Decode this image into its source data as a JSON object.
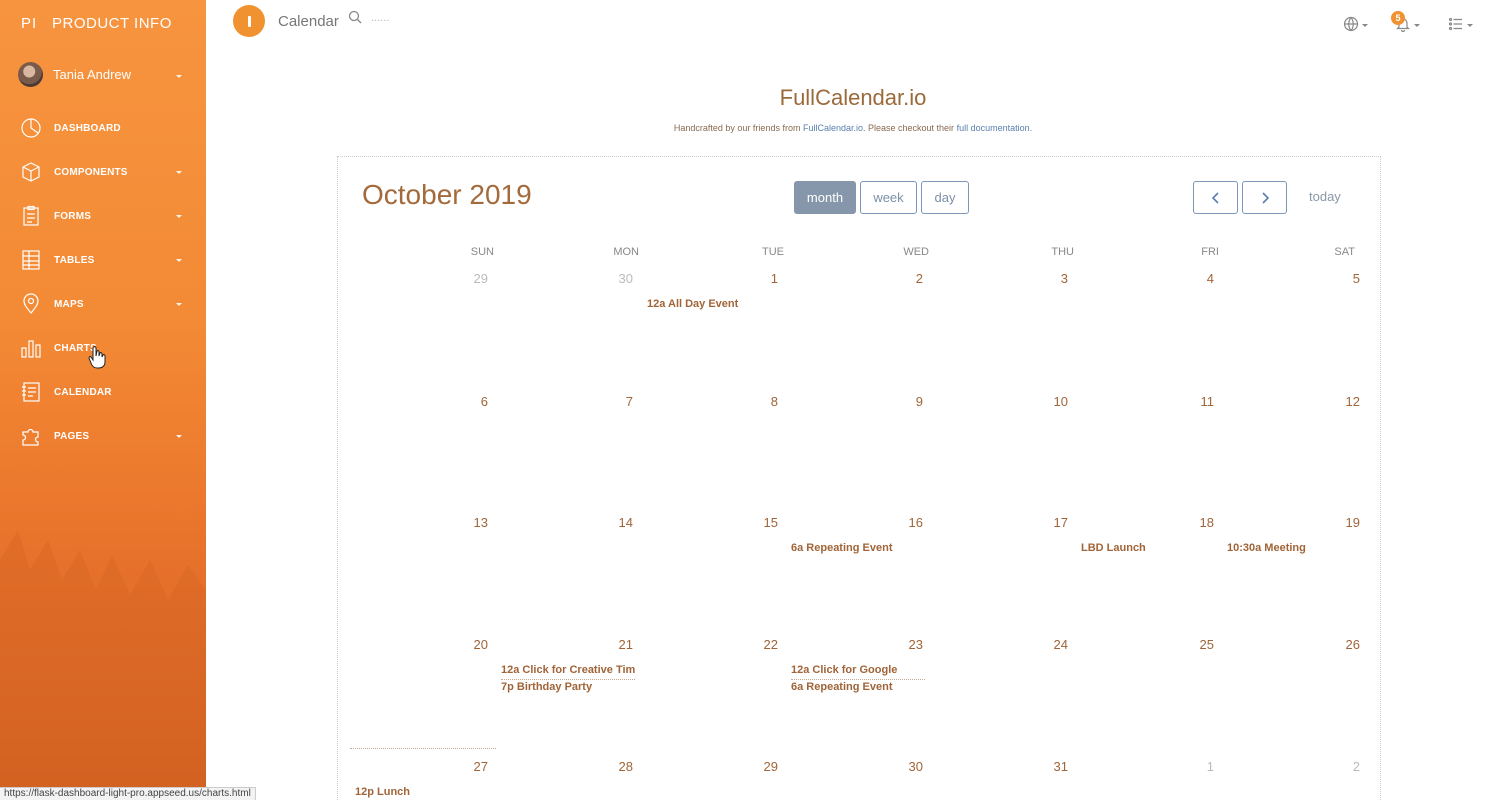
{
  "sidebar": {
    "brand_mini": "PI",
    "brand_full": "PRODUCT INFO",
    "user_name": "Tania Andrew",
    "items": [
      {
        "label": "DASHBOARD"
      },
      {
        "label": "COMPONENTS"
      },
      {
        "label": "FORMS"
      },
      {
        "label": "TABLES"
      },
      {
        "label": "MAPS"
      },
      {
        "label": "CHARTS"
      },
      {
        "label": "CALENDAR"
      },
      {
        "label": "PAGES"
      }
    ]
  },
  "statusbar": {
    "url": "https://flask-dashboard-light-pro.appseed.us/charts.html"
  },
  "topbar": {
    "title": "Calendar",
    "search_placeholder": "......",
    "notification_count": "5"
  },
  "header": {
    "title": "FullCalendar.io",
    "subtitle_prefix": "Handcrafted by our friends from ",
    "subtitle_link1": "FullCalendar.io",
    "subtitle_middle": ". Please checkout their ",
    "subtitle_link2": "full documentation.",
    "subtitle_suffix": ""
  },
  "calendar": {
    "title": "October 2019",
    "views": {
      "month": "month",
      "week": "week",
      "day": "day"
    },
    "active_view": "month",
    "today_label": "today",
    "weekdays": [
      "SUN",
      "MON",
      "TUE",
      "WED",
      "THU",
      "FRI",
      "SAT"
    ],
    "weeks": [
      [
        "29",
        "30",
        "1",
        "2",
        "3",
        "4",
        "5"
      ],
      [
        "6",
        "7",
        "8",
        "9",
        "10",
        "11",
        "12"
      ],
      [
        "13",
        "14",
        "15",
        "16",
        "17",
        "18",
        "19"
      ],
      [
        "20",
        "21",
        "22",
        "23",
        "24",
        "25",
        "26"
      ],
      [
        "27",
        "28",
        "29",
        "30",
        "31",
        "1",
        "2"
      ]
    ],
    "events": [
      "12a All Day Event",
      "6a Repeating Event",
      "LBD Launch",
      "10:30a Meeting",
      "12a Click for Creative Tim",
      "7p Birthday Party",
      "12a Click for Google",
      "6a Repeating Event",
      "12p Lunch"
    ]
  }
}
